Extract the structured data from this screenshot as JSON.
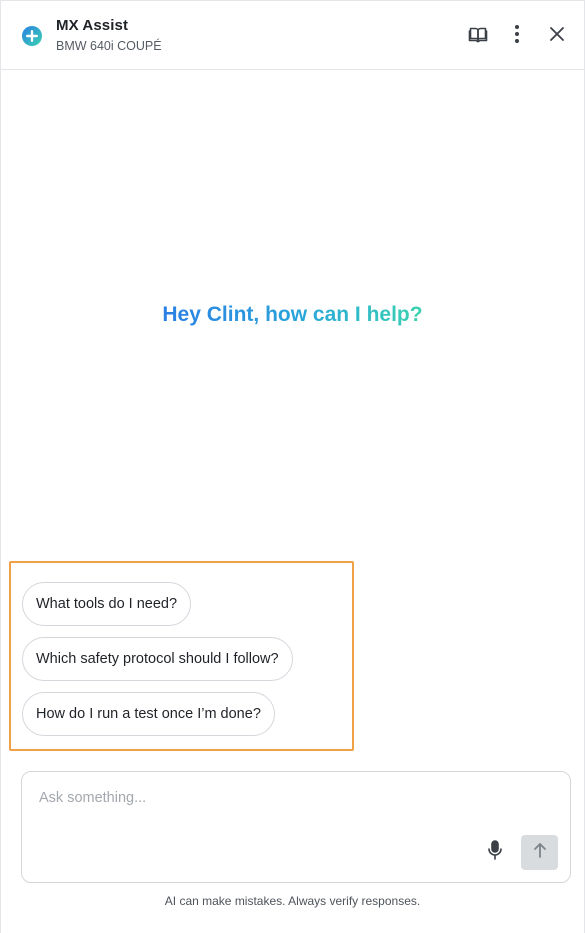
{
  "header": {
    "title": "MX Assist",
    "subtitle": "BMW 640i COUPÉ",
    "icons": {
      "logo": "plus-circle-icon",
      "guide": "book-icon",
      "more": "vertical-dots-icon",
      "close": "close-icon"
    }
  },
  "greeting": {
    "text": "Hey Clint, how can I help?",
    "gradient_colors": [
      "#2a7fe4",
      "#2aa6da",
      "#3ad3b0"
    ]
  },
  "suggestions": [
    {
      "label": "What tools do I need?"
    },
    {
      "label": "Which safety protocol should I follow?"
    },
    {
      "label": "How do I run a test once I’m done?"
    }
  ],
  "composer": {
    "placeholder": "Ask something...",
    "value": "",
    "mic_icon": "microphone-icon",
    "send_icon": "arrow-up-icon"
  },
  "footer": {
    "disclaimer": "AI can make mistakes. Always verify responses."
  },
  "colors": {
    "accent_blue": "#2b86e6",
    "highlight_border": "#f0a046"
  }
}
